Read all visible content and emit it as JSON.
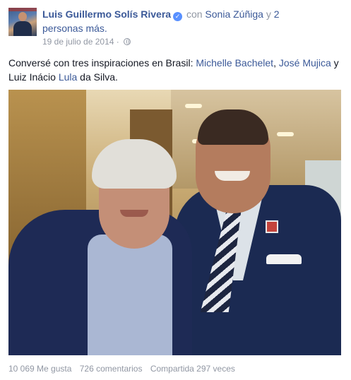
{
  "post": {
    "author": "Luis Guillermo Solís Rivera",
    "with_prefix": "con",
    "tagged_person": "Sonia Zúñiga",
    "tagged_conj": "y",
    "tagged_others_line1": "2",
    "tagged_others_line2": "personas más.",
    "date": "19 de julio de 2014",
    "date_separator": "·",
    "text_intro": "Conversé con tres inspiraciones en Brasil: ",
    "link1": "Michelle Bachelet",
    "sep1": ", ",
    "link2": "José Mujica",
    "sep2": " y Luiz Inácio ",
    "link3": "Lula",
    "text_end": " da Silva.",
    "icons": {
      "verified": "verified-badge-icon",
      "audience": "globe-icon"
    }
  },
  "stats": {
    "likes": "10 069 Me gusta",
    "comments": "726 comentarios",
    "shares": "Compartida 297 veces"
  },
  "colors": {
    "link": "#3b5998",
    "meta": "#9197a3",
    "verified": "#5890ff"
  }
}
